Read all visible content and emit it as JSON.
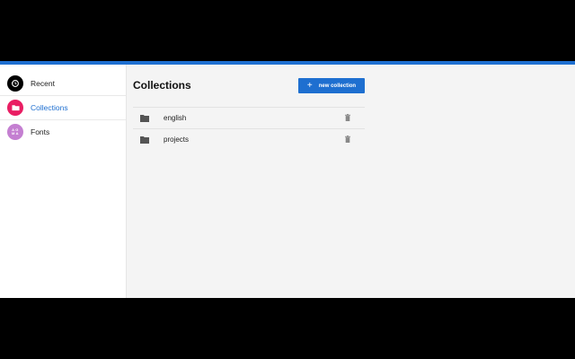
{
  "sidebar": {
    "items": [
      {
        "label": "Recent",
        "icon": "history-icon",
        "color": "#000000"
      },
      {
        "label": "Collections",
        "icon": "folder-icon",
        "color": "#e91e63"
      },
      {
        "label": "Fonts",
        "icon": "font-letters-icon",
        "color": "#c47fd1"
      }
    ],
    "active_index": 1
  },
  "main": {
    "title": "Collections",
    "new_button_label": "new collection",
    "collections": [
      {
        "name": "english"
      },
      {
        "name": "projects"
      }
    ]
  },
  "colors": {
    "accent": "#1e6fd0",
    "background": "#f4f4f4"
  }
}
